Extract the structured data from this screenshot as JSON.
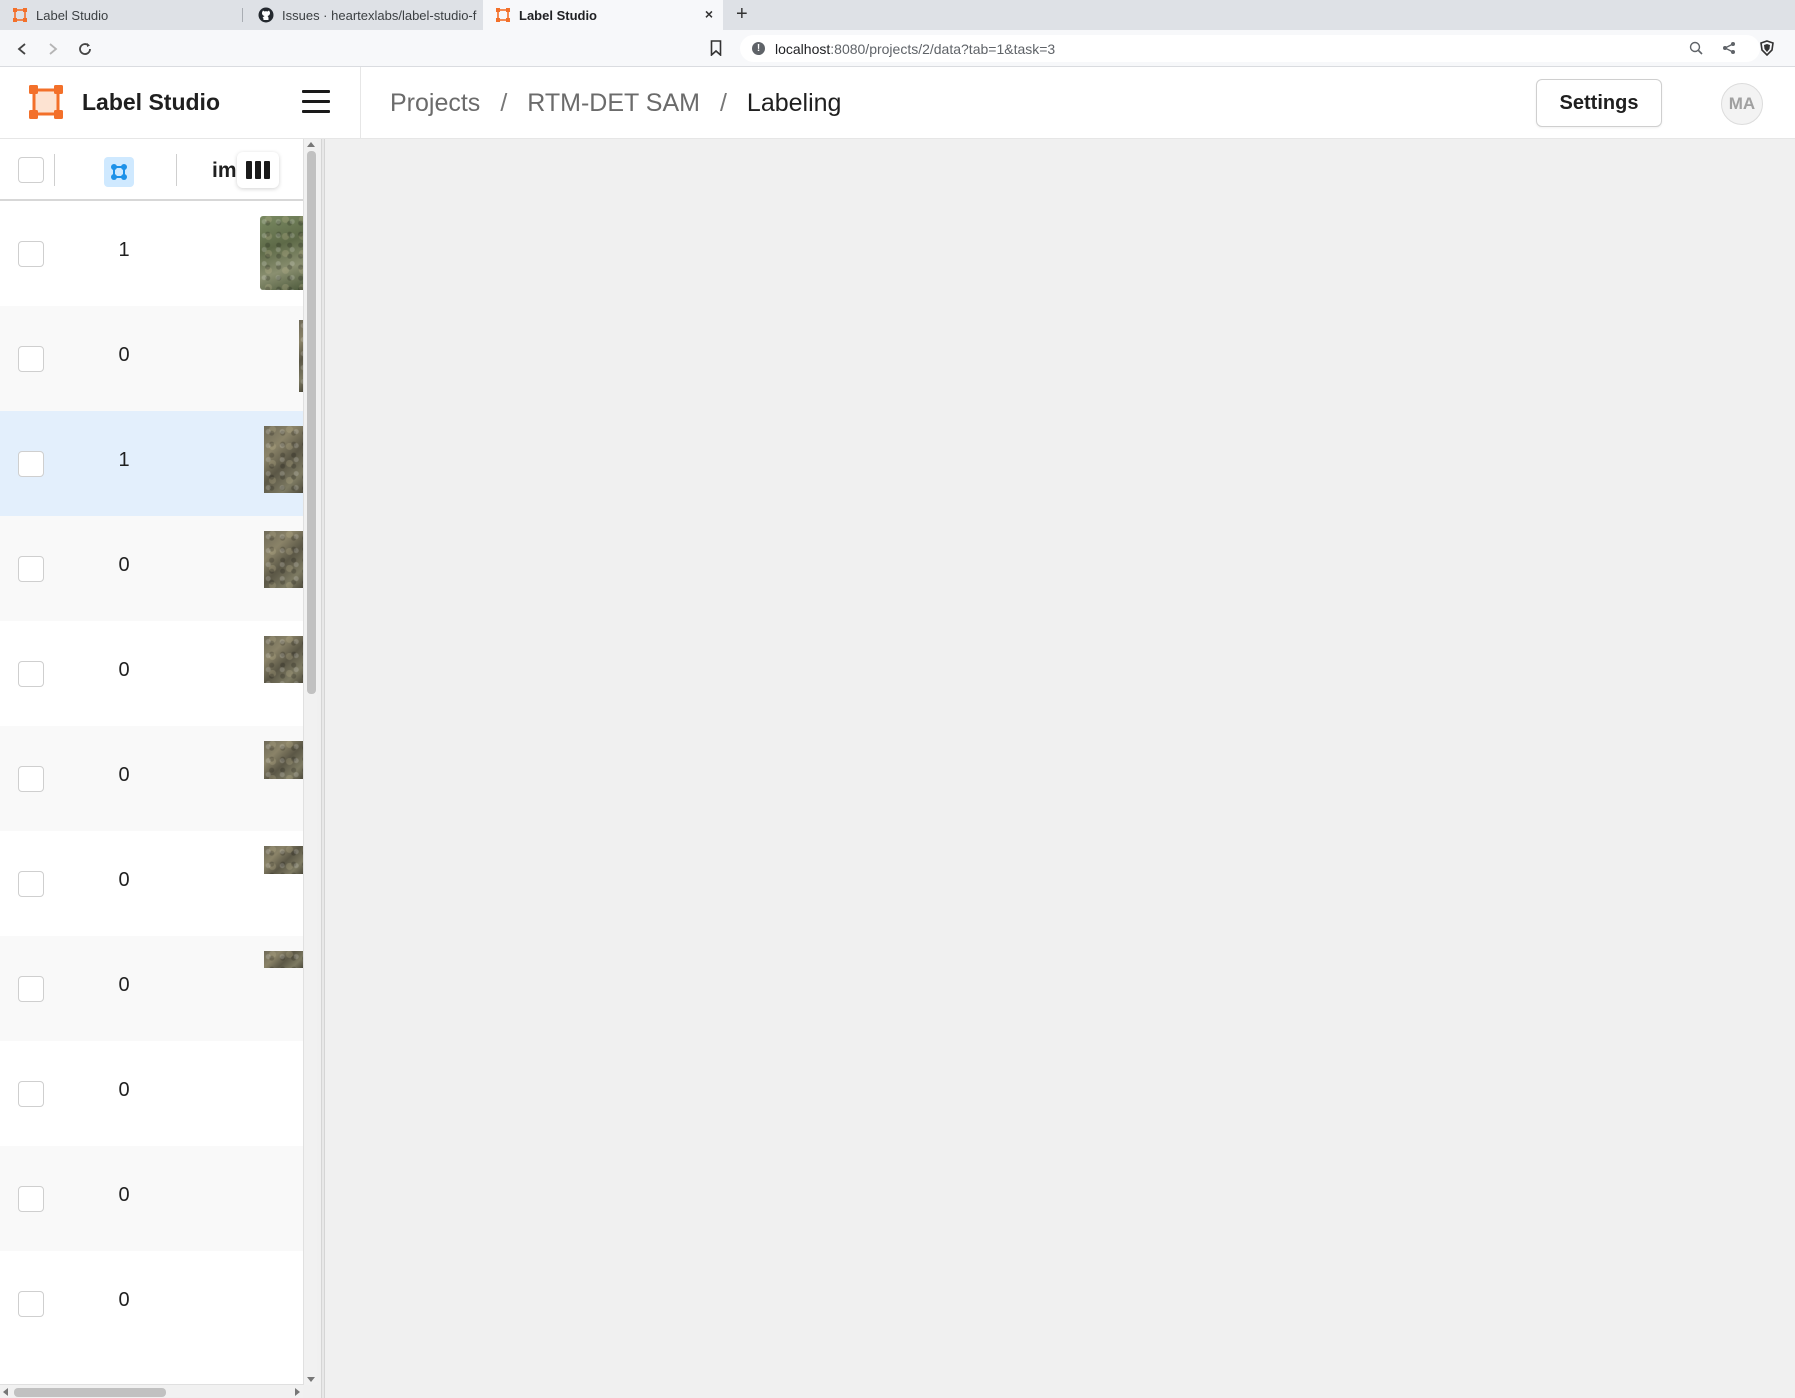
{
  "browser": {
    "tabs": [
      {
        "title": "Label Studio",
        "active": false
      },
      {
        "title": "Issues · heartexlabs/label-studio-f",
        "active": false
      },
      {
        "title": "Label Studio",
        "active": true
      }
    ],
    "close_glyph": "×",
    "newtab_glyph": "+",
    "url_host": "localhost",
    "url_rest": ":8080/projects/2/data?tab=1&task=3"
  },
  "app": {
    "brand": "Label Studio",
    "breadcrumb": {
      "projects": "Projects",
      "project": "RTM-DET SAM",
      "current": "Labeling",
      "separator": "/"
    },
    "settings_label": "Settings",
    "avatar_initials": "MA",
    "accent": "#f3702a"
  },
  "tasklist": {
    "header": {
      "column_label": "im"
    },
    "rows": [
      {
        "count": "1"
      },
      {
        "count": "0"
      },
      {
        "count": "1"
      },
      {
        "count": "0"
      },
      {
        "count": "0"
      },
      {
        "count": "0"
      },
      {
        "count": "0"
      },
      {
        "count": "0"
      },
      {
        "count": "0"
      },
      {
        "count": "0"
      },
      {
        "count": "0"
      }
    ]
  }
}
